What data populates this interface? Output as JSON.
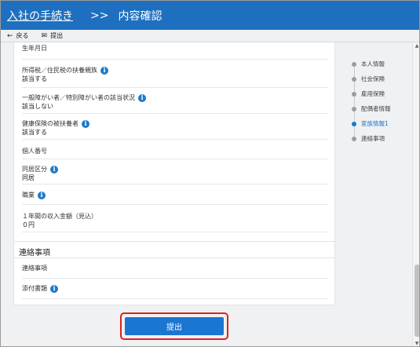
{
  "header": {
    "crumb": "入社の手続き",
    "separator": ">>",
    "title": "内容確認"
  },
  "toolbar": {
    "back_label": "戻る",
    "submit_label": "提出"
  },
  "section1": {
    "rows": [
      {
        "label": "生年月日",
        "value": ""
      },
      {
        "label": "所得税／住民税の扶養親族",
        "value": "該当する"
      },
      {
        "label": "一般障がい者／特別障がい者の該当状況",
        "value": "該当しない"
      },
      {
        "label": "健康保険の被扶養者",
        "value": "該当する"
      },
      {
        "label": "個人番号",
        "value": ""
      },
      {
        "label": "同居区分",
        "value": "同居"
      },
      {
        "label": "職業",
        "value": ""
      },
      {
        "label": "１年間の収入金額（見込）",
        "value": "０円"
      }
    ]
  },
  "section2": {
    "title": "連絡事項",
    "rows": [
      {
        "label": "連絡事項"
      },
      {
        "label": "添付書類"
      }
    ]
  },
  "sidenav": {
    "items": [
      {
        "label": "本人情報"
      },
      {
        "label": "社会保険"
      },
      {
        "label": "雇用保険"
      },
      {
        "label": "配偶者情報"
      },
      {
        "label": "家族情報1"
      },
      {
        "label": "連絡事項"
      }
    ],
    "active_index": 4
  },
  "submit_button": {
    "label": "提出"
  },
  "colors": {
    "header_bg": "#1e6fbf",
    "accent": "#1e78c8",
    "highlight_outline": "#e02020"
  }
}
